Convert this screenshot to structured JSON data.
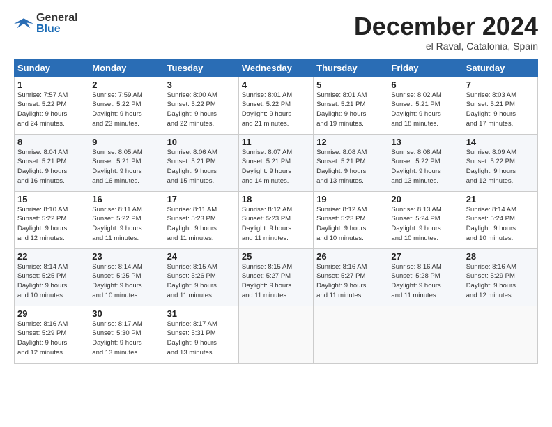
{
  "header": {
    "logo_general": "General",
    "logo_blue": "Blue",
    "title": "December 2024",
    "location": "el Raval, Catalonia, Spain"
  },
  "days_of_week": [
    "Sunday",
    "Monday",
    "Tuesday",
    "Wednesday",
    "Thursday",
    "Friday",
    "Saturday"
  ],
  "weeks": [
    [
      {
        "day": "1",
        "info": "Sunrise: 7:57 AM\nSunset: 5:22 PM\nDaylight: 9 hours\nand 24 minutes."
      },
      {
        "day": "2",
        "info": "Sunrise: 7:59 AM\nSunset: 5:22 PM\nDaylight: 9 hours\nand 23 minutes."
      },
      {
        "day": "3",
        "info": "Sunrise: 8:00 AM\nSunset: 5:22 PM\nDaylight: 9 hours\nand 22 minutes."
      },
      {
        "day": "4",
        "info": "Sunrise: 8:01 AM\nSunset: 5:22 PM\nDaylight: 9 hours\nand 21 minutes."
      },
      {
        "day": "5",
        "info": "Sunrise: 8:01 AM\nSunset: 5:21 PM\nDaylight: 9 hours\nand 19 minutes."
      },
      {
        "day": "6",
        "info": "Sunrise: 8:02 AM\nSunset: 5:21 PM\nDaylight: 9 hours\nand 18 minutes."
      },
      {
        "day": "7",
        "info": "Sunrise: 8:03 AM\nSunset: 5:21 PM\nDaylight: 9 hours\nand 17 minutes."
      }
    ],
    [
      {
        "day": "8",
        "info": "Sunrise: 8:04 AM\nSunset: 5:21 PM\nDaylight: 9 hours\nand 16 minutes."
      },
      {
        "day": "9",
        "info": "Sunrise: 8:05 AM\nSunset: 5:21 PM\nDaylight: 9 hours\nand 16 minutes."
      },
      {
        "day": "10",
        "info": "Sunrise: 8:06 AM\nSunset: 5:21 PM\nDaylight: 9 hours\nand 15 minutes."
      },
      {
        "day": "11",
        "info": "Sunrise: 8:07 AM\nSunset: 5:21 PM\nDaylight: 9 hours\nand 14 minutes."
      },
      {
        "day": "12",
        "info": "Sunrise: 8:08 AM\nSunset: 5:21 PM\nDaylight: 9 hours\nand 13 minutes."
      },
      {
        "day": "13",
        "info": "Sunrise: 8:08 AM\nSunset: 5:22 PM\nDaylight: 9 hours\nand 13 minutes."
      },
      {
        "day": "14",
        "info": "Sunrise: 8:09 AM\nSunset: 5:22 PM\nDaylight: 9 hours\nand 12 minutes."
      }
    ],
    [
      {
        "day": "15",
        "info": "Sunrise: 8:10 AM\nSunset: 5:22 PM\nDaylight: 9 hours\nand 12 minutes."
      },
      {
        "day": "16",
        "info": "Sunrise: 8:11 AM\nSunset: 5:22 PM\nDaylight: 9 hours\nand 11 minutes."
      },
      {
        "day": "17",
        "info": "Sunrise: 8:11 AM\nSunset: 5:23 PM\nDaylight: 9 hours\nand 11 minutes."
      },
      {
        "day": "18",
        "info": "Sunrise: 8:12 AM\nSunset: 5:23 PM\nDaylight: 9 hours\nand 11 minutes."
      },
      {
        "day": "19",
        "info": "Sunrise: 8:12 AM\nSunset: 5:23 PM\nDaylight: 9 hours\nand 10 minutes."
      },
      {
        "day": "20",
        "info": "Sunrise: 8:13 AM\nSunset: 5:24 PM\nDaylight: 9 hours\nand 10 minutes."
      },
      {
        "day": "21",
        "info": "Sunrise: 8:14 AM\nSunset: 5:24 PM\nDaylight: 9 hours\nand 10 minutes."
      }
    ],
    [
      {
        "day": "22",
        "info": "Sunrise: 8:14 AM\nSunset: 5:25 PM\nDaylight: 9 hours\nand 10 minutes."
      },
      {
        "day": "23",
        "info": "Sunrise: 8:14 AM\nSunset: 5:25 PM\nDaylight: 9 hours\nand 10 minutes."
      },
      {
        "day": "24",
        "info": "Sunrise: 8:15 AM\nSunset: 5:26 PM\nDaylight: 9 hours\nand 11 minutes."
      },
      {
        "day": "25",
        "info": "Sunrise: 8:15 AM\nSunset: 5:27 PM\nDaylight: 9 hours\nand 11 minutes."
      },
      {
        "day": "26",
        "info": "Sunrise: 8:16 AM\nSunset: 5:27 PM\nDaylight: 9 hours\nand 11 minutes."
      },
      {
        "day": "27",
        "info": "Sunrise: 8:16 AM\nSunset: 5:28 PM\nDaylight: 9 hours\nand 11 minutes."
      },
      {
        "day": "28",
        "info": "Sunrise: 8:16 AM\nSunset: 5:29 PM\nDaylight: 9 hours\nand 12 minutes."
      }
    ],
    [
      {
        "day": "29",
        "info": "Sunrise: 8:16 AM\nSunset: 5:29 PM\nDaylight: 9 hours\nand 12 minutes."
      },
      {
        "day": "30",
        "info": "Sunrise: 8:17 AM\nSunset: 5:30 PM\nDaylight: 9 hours\nand 13 minutes."
      },
      {
        "day": "31",
        "info": "Sunrise: 8:17 AM\nSunset: 5:31 PM\nDaylight: 9 hours\nand 13 minutes."
      },
      null,
      null,
      null,
      null
    ]
  ]
}
